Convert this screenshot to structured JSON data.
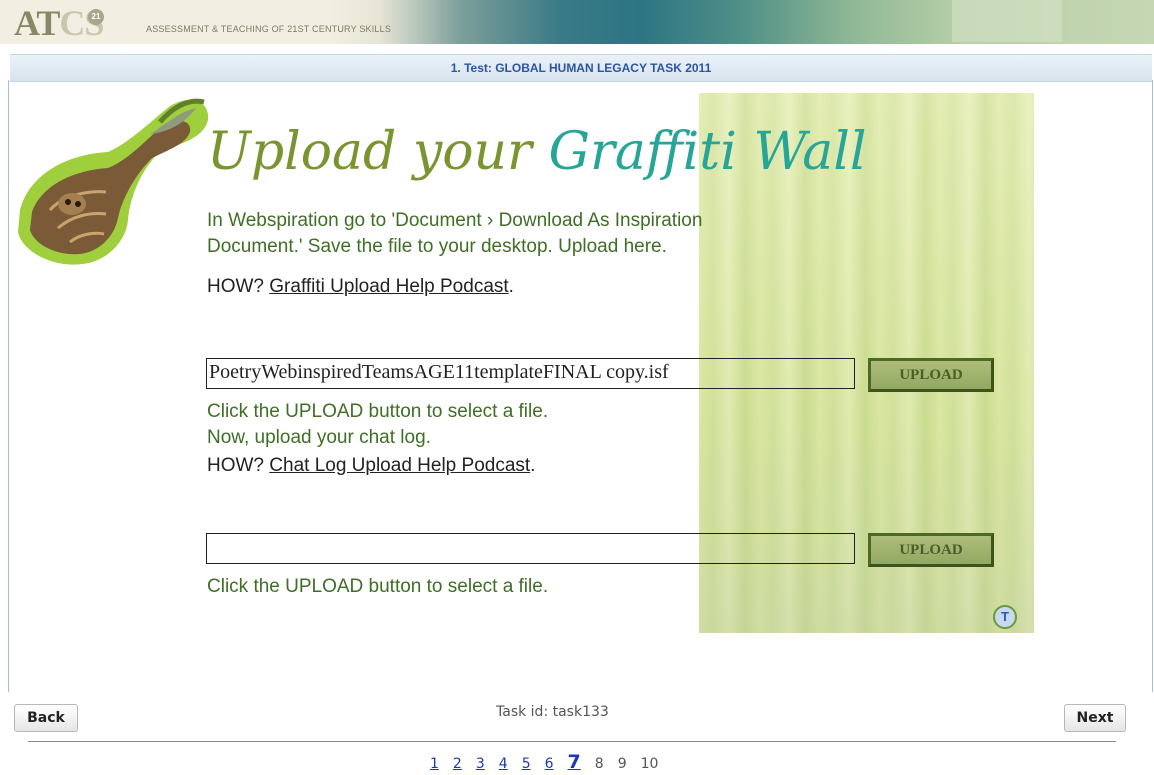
{
  "header": {
    "logo_text_a": "AT",
    "logo_text_c": "C",
    "logo_text_s": "S",
    "logo_badge": "21",
    "tagline": "ASSESSMENT & TEACHING OF 21ST CENTURY SKILLS"
  },
  "test_title": "1. Test: GLOBAL HUMAN LEGACY TASK 2011",
  "headline": {
    "part1": "Upload your ",
    "part2": "Graffiti Wall"
  },
  "instructions": {
    "line1": "In Webspiration go to 'Document › Download As Inspiration",
    "line2": "Document.' Save the file to your desktop. Upload here.",
    "how1_prefix": "HOW? ",
    "how1_link": "Graffiti Upload Help Podcast",
    "how1_suffix": "."
  },
  "upload1": {
    "filename": "PoetryWebinspiredTeamsAGE11templateFINAL copy.isf",
    "button": "UPLOAD",
    "hint": "Click the UPLOAD button to select a file."
  },
  "chatlog": {
    "line": "Now, upload your chat log.",
    "how_prefix": "HOW? ",
    "how_link": "Chat Log Upload Help Podcast",
    "how_suffix": "."
  },
  "upload2": {
    "filename": "",
    "button": "UPLOAD",
    "hint": "Click the UPLOAD button to select a file."
  },
  "t_badge": "T",
  "footer": {
    "back": "Back",
    "next": "Next",
    "task_id": "Task id: task133",
    "pages": [
      "1",
      "2",
      "3",
      "4",
      "5",
      "6",
      "7",
      "8",
      "9",
      "10"
    ],
    "current_page": "7"
  },
  "colors": {
    "headline_green": "#7a9530",
    "headline_teal": "#27a597",
    "body_green": "#3f6e25",
    "title_blue": "#2c55a0",
    "link_blue": "#1e39b0"
  },
  "icons": [
    "sloth-logo-icon",
    "t-badge-icon"
  ]
}
